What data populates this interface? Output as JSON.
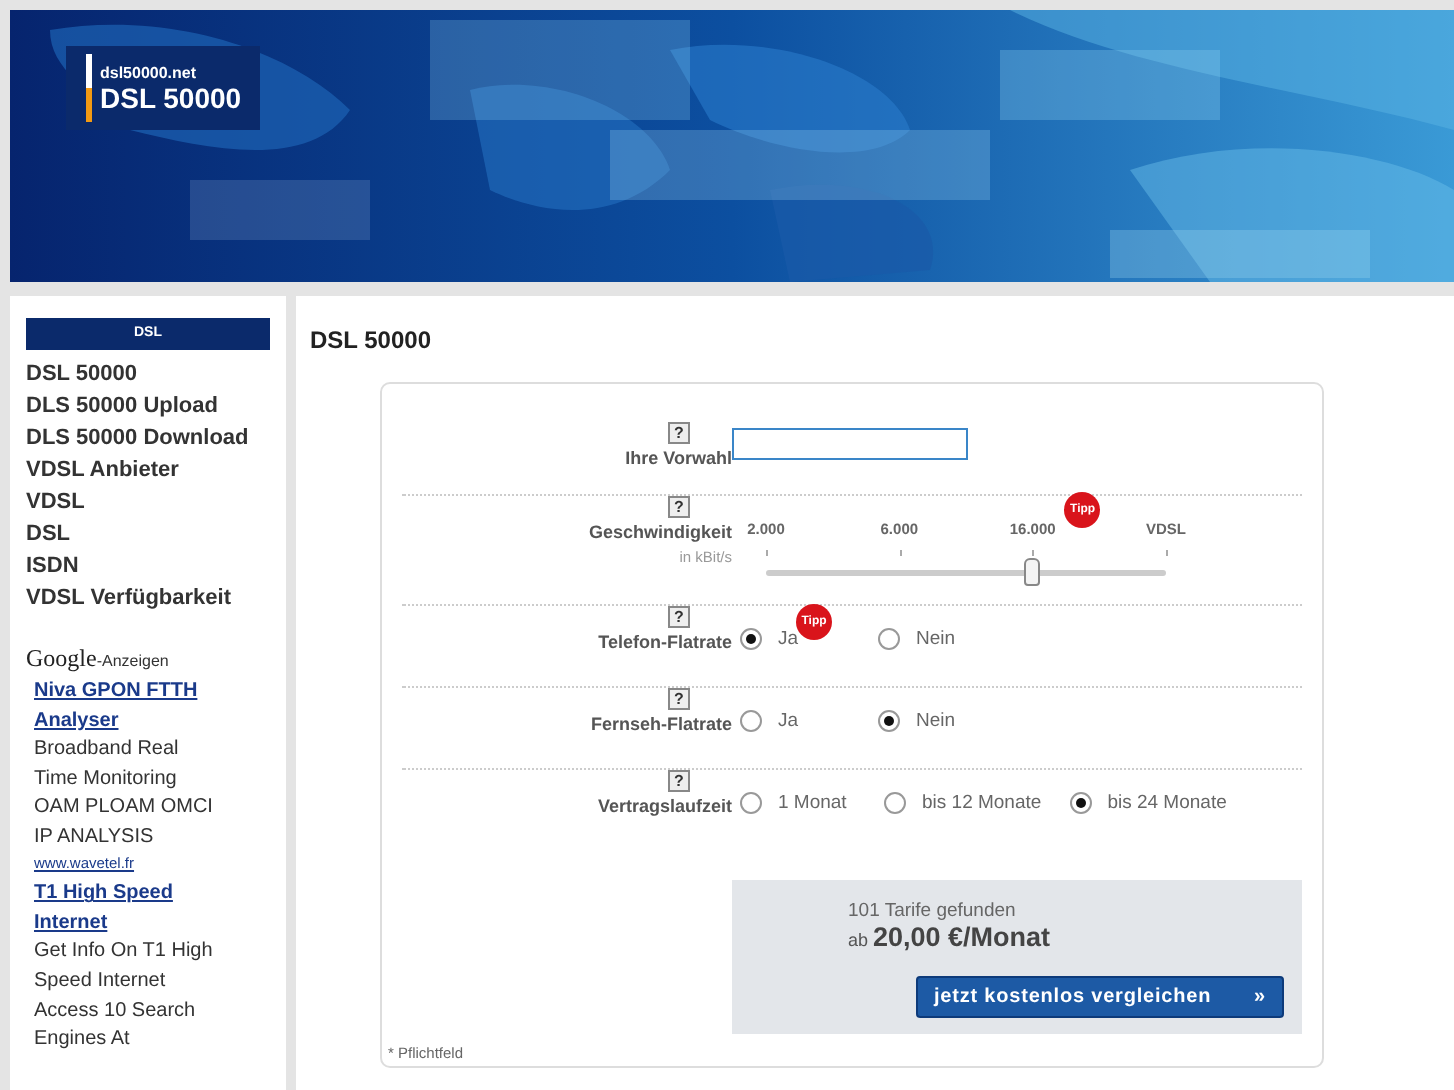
{
  "banner": {
    "logo_domain": "dsl50000.net",
    "logo_title": "DSL 50000"
  },
  "sidebar": {
    "heading": "DSL",
    "items": [
      "DSL 50000",
      "DLS 50000 Upload",
      "DLS 50000 Download",
      "VDSL Anbieter",
      "VDSL",
      "DSL",
      "ISDN",
      "VDSL Verfügbarkeit"
    ],
    "ads_brand": "Google",
    "ads_label": "-Anzeigen",
    "ads": [
      {
        "title": "Niva GPON FTTH Analyser",
        "text": "Broadband Real Time Monitoring OAM PLOAM OMCI IP ANALYSIS",
        "url": "www.wavetel.fr"
      },
      {
        "title": "T1 High Speed Internet",
        "text": "Get Info On T1 High Speed Internet Access 10 Search Engines At"
      }
    ]
  },
  "page_title": "DSL 50000",
  "form": {
    "rows": [
      {
        "kind": "text",
        "label": "Ihre Vorwahl",
        "help": "?"
      },
      {
        "kind": "slider",
        "label": "Geschwindigkeit",
        "unit": "in kBit/s",
        "help": "?",
        "ticks": [
          {
            "label": "2.000"
          },
          {
            "label": "6.000"
          },
          {
            "label": "16.000",
            "badge": "Tipp"
          },
          {
            "label": "VDSL"
          }
        ],
        "level": 0.667
      },
      {
        "kind": "radio",
        "label": "Telefon-Flatrate",
        "help": "?",
        "options": [
          {
            "label": "Ja",
            "selected": true,
            "badge": "Tipp"
          },
          {
            "label": "Nein",
            "selected": false
          }
        ]
      },
      {
        "kind": "radio",
        "label": "Fernseh-Flatrate",
        "help": "?",
        "options": [
          {
            "label": "Ja",
            "selected": false
          },
          {
            "label": "Nein",
            "selected": true
          }
        ]
      },
      {
        "kind": "radio",
        "label": "Vertragslaufzeit",
        "help": "?",
        "options": [
          {
            "label": "1 Monat",
            "selected": false
          },
          {
            "label": "bis 12 Monate",
            "selected": false
          },
          {
            "label": "bis 24 Monate",
            "selected": true
          }
        ]
      }
    ],
    "result": {
      "count": "101 Tarife gefunden",
      "price_prefix": "ab",
      "price": "20,00 €/Monat",
      "button": "jetzt kostenlos vergleichen",
      "button_icon": "»"
    },
    "footnote": "* Pflichtfeld"
  }
}
